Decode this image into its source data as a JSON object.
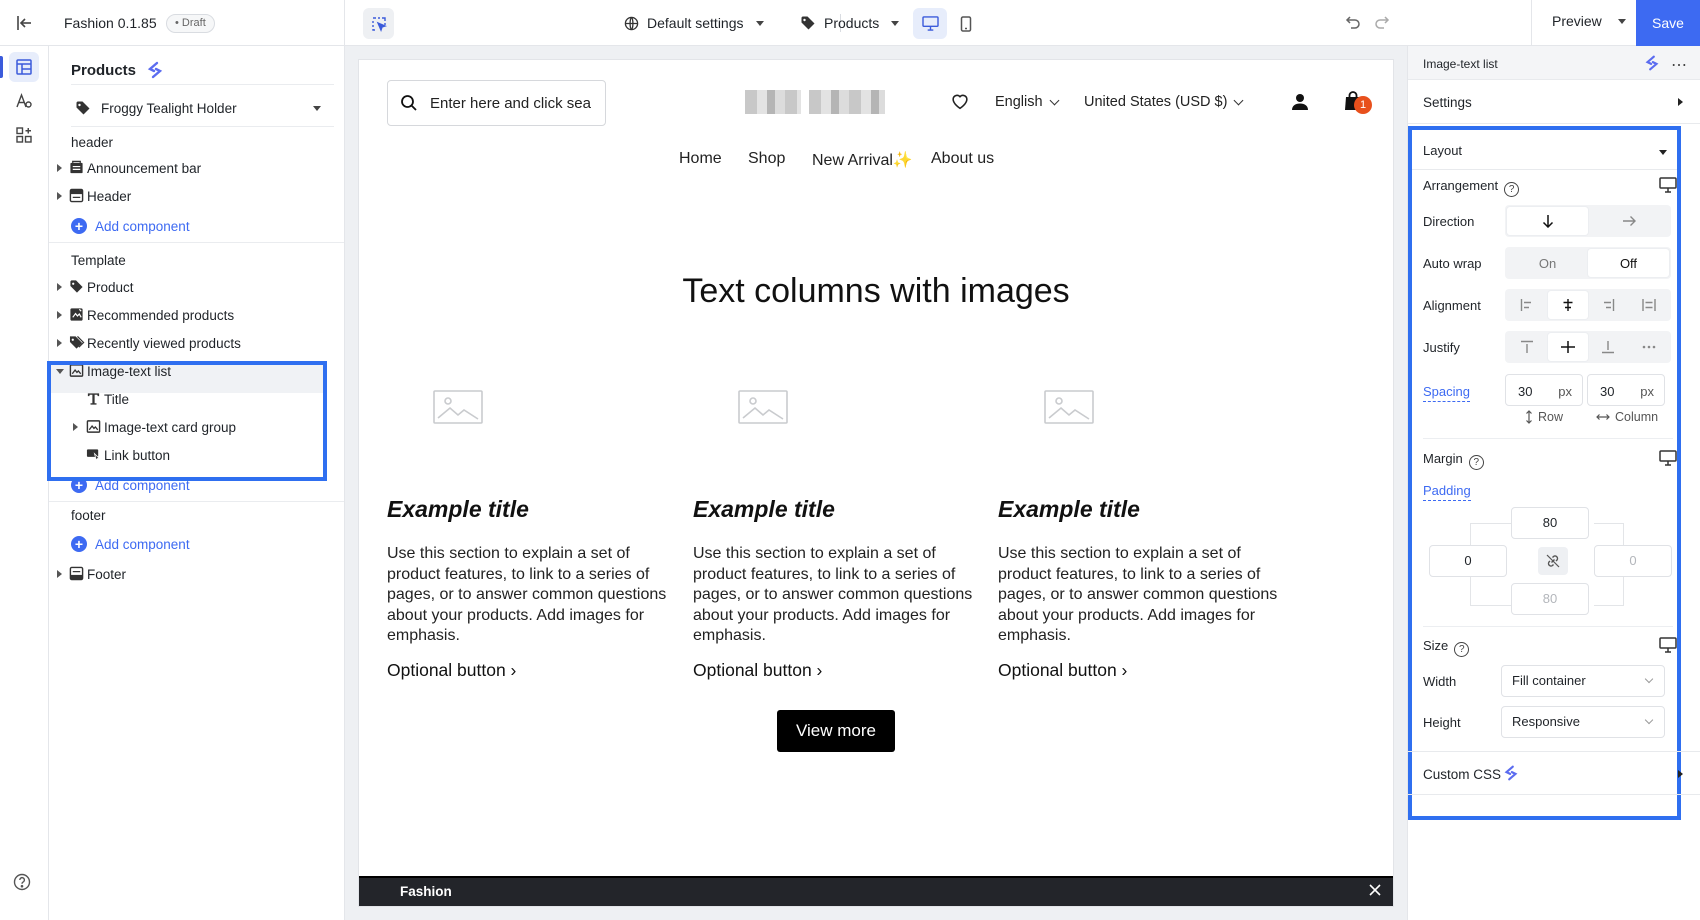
{
  "topbar": {
    "app_title": "Fashion 0.1.85",
    "draft_badge": "• Draft",
    "settings_label": "Default settings",
    "page_type_label": "Products",
    "preview_label": "Preview",
    "save_label": "Save"
  },
  "left_panel": {
    "title": "Products",
    "page_select": "Froggy Tealight Holder",
    "group_header": "header",
    "group_template": "Template",
    "group_footer": "footer",
    "add_component": "Add component",
    "header_items": [
      {
        "label": "Announcement bar",
        "icon": "announcement-icon"
      },
      {
        "label": "Header",
        "icon": "header-layout-icon"
      }
    ],
    "template_items": [
      {
        "label": "Product",
        "icon": "tag-icon"
      },
      {
        "label": "Recommended products",
        "icon": "recommended-icon"
      },
      {
        "label": "Recently viewed products",
        "icon": "tags-icon"
      },
      {
        "label": "Image-text list",
        "icon": "image-icon",
        "expanded": true
      }
    ],
    "image_text_children": [
      {
        "label": "Title",
        "icon": "text-icon"
      },
      {
        "label": "Image-text card group",
        "icon": "image-icon"
      },
      {
        "label": "Link button",
        "icon": "link-button-icon"
      }
    ],
    "footer_items": [
      {
        "label": "Footer",
        "icon": "footer-layout-icon"
      }
    ]
  },
  "store": {
    "search_placeholder": "Enter here and click sea",
    "language": "English",
    "currency": "United States (USD $)",
    "cart_count": "1",
    "nav": [
      "Home",
      "Shop",
      "New Arrival",
      "About us"
    ],
    "nav_sparkle": "✨",
    "section_title": "Text columns with images",
    "columns": [
      {
        "title": "Example title",
        "text": "Use this section to explain a set of product features, to link to a series of pages, or to answer common questions about your products. Add images for emphasis.",
        "button": "Optional button ›"
      },
      {
        "title": "Example title",
        "text": "Use this section to explain a set of product features, to link to a series of pages, or to answer common questions about your products. Add images for emphasis.",
        "button": "Optional button ›"
      },
      {
        "title": "Example title",
        "text": "Use this section to explain a set of product features, to link to a series of pages, or to answer common questions about your products. Add images for emphasis.",
        "button": "Optional button ›"
      }
    ],
    "view_more": "View more",
    "footer_label": "Fashion"
  },
  "right_panel": {
    "title": "Image-text list",
    "settings_label": "Settings",
    "layout_label": "Layout",
    "arrangement_label": "Arrangement",
    "direction_label": "Direction",
    "auto_wrap_label": "Auto wrap",
    "auto_wrap_on": "On",
    "auto_wrap_off": "Off",
    "alignment_label": "Alignment",
    "justify_label": "Justify",
    "spacing_label": "Spacing",
    "spacing_row": {
      "value": "30",
      "unit": "px",
      "label": "Row"
    },
    "spacing_column": {
      "value": "30",
      "unit": "px",
      "label": "Column"
    },
    "margin_label": "Margin",
    "padding_label": "Padding",
    "padding": {
      "top": "80",
      "left": "0",
      "right": "0",
      "bottom": "80"
    },
    "size_label": "Size",
    "width_label": "Width",
    "width_value": "Fill container",
    "height_label": "Height",
    "height_value": "Responsive",
    "custom_css_label": "Custom CSS"
  },
  "colors": {
    "accent": "#3d6af2",
    "highlight_border": "#2f6ff0",
    "cart_badge": "#e8501c"
  }
}
